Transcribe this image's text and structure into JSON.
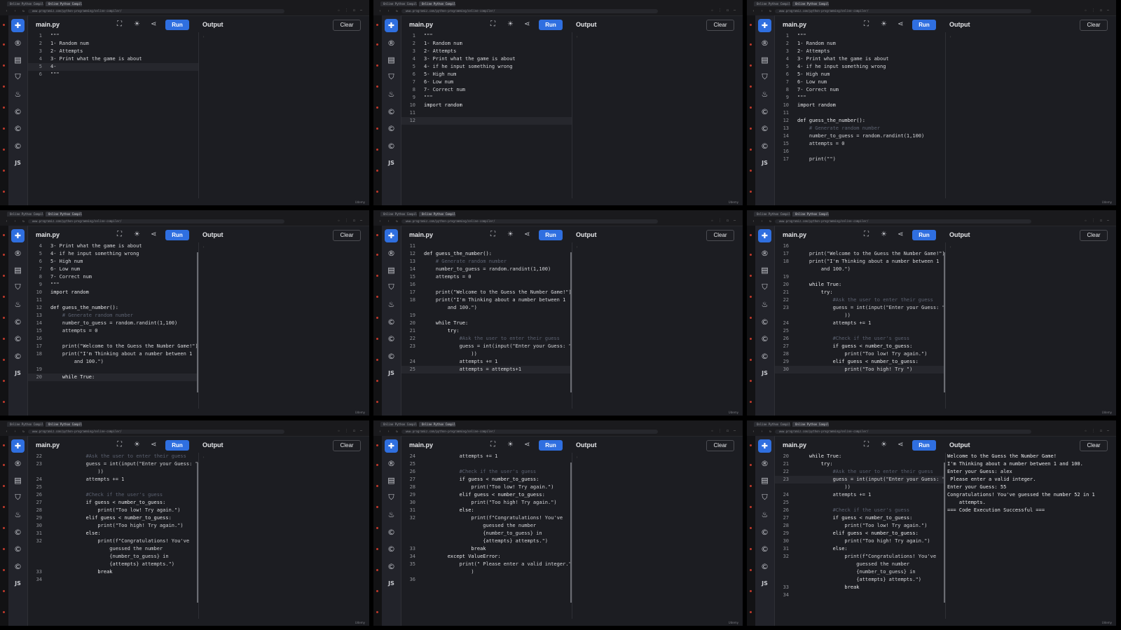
{
  "browser": {
    "tabs": [
      "Online Python Compiler",
      "Online Python Compiler"
    ],
    "url": "www.programiz.com/python-programming/online-compiler/"
  },
  "toolbar": {
    "file_name": "main.py",
    "run_label": "Run",
    "output_label": "Output",
    "clear_label": "Clear"
  },
  "sidebar_icons": [
    "python-icon",
    "r-icon",
    "sql-icon",
    "html-icon",
    "java-icon",
    "c-icon",
    "cpp-icon",
    "csharp-icon",
    "js-icon"
  ],
  "brand": "Udemy",
  "colors": {
    "accent": "#2f6fe0",
    "background": "#1c1d22",
    "sidebar": "#22232a"
  },
  "panels": [
    {
      "lines": [
        {
          "n": "1",
          "t": "\"\"\""
        },
        {
          "n": "2",
          "t": "1- Random num"
        },
        {
          "n": "3",
          "t": "2- Attempts"
        },
        {
          "n": "4",
          "t": "3- Print what the game is about"
        },
        {
          "n": "5",
          "t": "4-",
          "hl": true
        },
        {
          "n": "6",
          "t": "\"\"\""
        }
      ],
      "output": []
    },
    {
      "lines": [
        {
          "n": "1",
          "t": "\"\"\""
        },
        {
          "n": "2",
          "t": "1- Random num"
        },
        {
          "n": "3",
          "t": "2- Attempts"
        },
        {
          "n": "4",
          "t": "3- Print what the game is about"
        },
        {
          "n": "5",
          "t": "4- if he input something wrong"
        },
        {
          "n": "6",
          "t": "5- High num"
        },
        {
          "n": "7",
          "t": "6- Low num"
        },
        {
          "n": "8",
          "t": "7- Correct num"
        },
        {
          "n": "9",
          "t": "\"\"\""
        },
        {
          "n": "10",
          "t": "import random"
        },
        {
          "n": "11",
          "t": ""
        },
        {
          "n": "12",
          "t": "",
          "hl": true
        }
      ],
      "output": []
    },
    {
      "lines": [
        {
          "n": "1",
          "t": "\"\"\""
        },
        {
          "n": "2",
          "t": "1- Random num"
        },
        {
          "n": "3",
          "t": "2- Attempts"
        },
        {
          "n": "4",
          "t": "3- Print what the game is about"
        },
        {
          "n": "5",
          "t": "4- if he input something wrong"
        },
        {
          "n": "6",
          "t": "5- High num"
        },
        {
          "n": "7",
          "t": "6- Low num"
        },
        {
          "n": "8",
          "t": "7- Correct num"
        },
        {
          "n": "9",
          "t": "\"\"\""
        },
        {
          "n": "10",
          "t": "import random"
        },
        {
          "n": "11",
          "t": ""
        },
        {
          "n": "12",
          "t": "def guess_the_number():"
        },
        {
          "n": "13",
          "t": "    # Generate random number"
        },
        {
          "n": "14",
          "t": "    number_to_guess = random.randint(1,100)"
        },
        {
          "n": "15",
          "t": "    attempts = 0"
        },
        {
          "n": "16",
          "t": ""
        },
        {
          "n": "17",
          "t": "    print(\"\")"
        }
      ],
      "output": []
    },
    {
      "lines": [
        {
          "n": "4",
          "t": "3- Print what the game is about"
        },
        {
          "n": "5",
          "t": "4- if he input something wrong"
        },
        {
          "n": "6",
          "t": "5- High num"
        },
        {
          "n": "7",
          "t": "6- Low num"
        },
        {
          "n": "8",
          "t": "7- Correct num"
        },
        {
          "n": "9",
          "t": "\"\"\""
        },
        {
          "n": "10",
          "t": "import random"
        },
        {
          "n": "11",
          "t": ""
        },
        {
          "n": "12",
          "t": "def guess_the_number():"
        },
        {
          "n": "13",
          "t": "    # Generate random number"
        },
        {
          "n": "14",
          "t": "    number_to_guess = random.randint(1,100)"
        },
        {
          "n": "15",
          "t": "    attempts = 0"
        },
        {
          "n": "16",
          "t": ""
        },
        {
          "n": "17",
          "t": "    print(\"Welcome to the Guess the Number Game!\")"
        },
        {
          "n": "18",
          "t": "    print(\"I'm Thinking about a number between 1"
        },
        {
          "n": "",
          "t": "        and 100.\")"
        },
        {
          "n": "19",
          "t": ""
        },
        {
          "n": "20",
          "t": "    while True:",
          "hl": true
        }
      ],
      "output": []
    },
    {
      "lines": [
        {
          "n": "11",
          "t": ""
        },
        {
          "n": "12",
          "t": "def guess_the_number():"
        },
        {
          "n": "13",
          "t": "    # Generate random number"
        },
        {
          "n": "14",
          "t": "    number_to_guess = random.randint(1,100)"
        },
        {
          "n": "15",
          "t": "    attempts = 0"
        },
        {
          "n": "16",
          "t": ""
        },
        {
          "n": "17",
          "t": "    print(\"Welcome to the Guess the Number Game!\")"
        },
        {
          "n": "18",
          "t": "    print(\"I'm Thinking about a number between 1"
        },
        {
          "n": "",
          "t": "        and 100.\")"
        },
        {
          "n": "19",
          "t": ""
        },
        {
          "n": "20",
          "t": "    while True:"
        },
        {
          "n": "21",
          "t": "        try:"
        },
        {
          "n": "22",
          "t": "            #Ask the user to enter their guess"
        },
        {
          "n": "23",
          "t": "            guess = int(input(\"Enter your Guess: \""
        },
        {
          "n": "",
          "t": "                ))"
        },
        {
          "n": "24",
          "t": "            attempts += 1"
        },
        {
          "n": "25",
          "t": "            attempts = attempts+1",
          "hl": true
        }
      ],
      "output": []
    },
    {
      "lines": [
        {
          "n": "16",
          "t": ""
        },
        {
          "n": "17",
          "t": "    print(\"Welcome to the Guess the Number Game!\")"
        },
        {
          "n": "18",
          "t": "    print(\"I'm Thinking about a number between 1"
        },
        {
          "n": "",
          "t": "        and 100.\")"
        },
        {
          "n": "19",
          "t": ""
        },
        {
          "n": "20",
          "t": "    while True:"
        },
        {
          "n": "21",
          "t": "        try:"
        },
        {
          "n": "22",
          "t": "            #Ask the user to enter their guess"
        },
        {
          "n": "23",
          "t": "            guess = int(input(\"Enter your Guess: \""
        },
        {
          "n": "",
          "t": "                ))"
        },
        {
          "n": "24",
          "t": "            attempts += 1"
        },
        {
          "n": "25",
          "t": ""
        },
        {
          "n": "26",
          "t": "            #Check if the user's guess"
        },
        {
          "n": "27",
          "t": "            if guess < number_to_guess:"
        },
        {
          "n": "28",
          "t": "                print(\"Too low! Try again.\")"
        },
        {
          "n": "29",
          "t": "            elif guess < number_to_guess:"
        },
        {
          "n": "30",
          "t": "                print(\"Too high! Try \")",
          "hl": true
        }
      ],
      "output": []
    },
    {
      "lines": [
        {
          "n": "22",
          "t": "            #Ask the user to enter their guess"
        },
        {
          "n": "23",
          "t": "            guess = int(input(\"Enter your Guess: \""
        },
        {
          "n": "",
          "t": "                ))"
        },
        {
          "n": "24",
          "t": "            attempts += 1"
        },
        {
          "n": "25",
          "t": ""
        },
        {
          "n": "26",
          "t": "            #Check if the user's guess"
        },
        {
          "n": "27",
          "t": "            if guess < number_to_guess:"
        },
        {
          "n": "28",
          "t": "                print(\"Too low! Try again.\")"
        },
        {
          "n": "29",
          "t": "            elif guess < number_to_guess:"
        },
        {
          "n": "30",
          "t": "                print(\"Too high! Try again.\")"
        },
        {
          "n": "31",
          "t": "            else:"
        },
        {
          "n": "32",
          "t": "                print(f\"Congratulations! You've"
        },
        {
          "n": "",
          "t": "                    guessed the number"
        },
        {
          "n": "",
          "t": "                    {number_to_guess} in"
        },
        {
          "n": "",
          "t": "                    {attempts} attempts.\")"
        },
        {
          "n": "33",
          "t": "                break"
        },
        {
          "n": "34",
          "t": ""
        }
      ],
      "output": []
    },
    {
      "lines": [
        {
          "n": "24",
          "t": "            attempts += 1"
        },
        {
          "n": "25",
          "t": ""
        },
        {
          "n": "26",
          "t": "            #Check if the user's guess"
        },
        {
          "n": "27",
          "t": "            if guess < number_to_guess:"
        },
        {
          "n": "28",
          "t": "                print(\"Too low! Try again.\")"
        },
        {
          "n": "29",
          "t": "            elif guess < number_to_guess:"
        },
        {
          "n": "30",
          "t": "                print(\"Too high! Try again.\")"
        },
        {
          "n": "31",
          "t": "            else:"
        },
        {
          "n": "32",
          "t": "                print(f\"Congratulations! You've"
        },
        {
          "n": "",
          "t": "                    guessed the number"
        },
        {
          "n": "",
          "t": "                    {number_to_guess} in"
        },
        {
          "n": "",
          "t": "                    {attempts} attempts.\")"
        },
        {
          "n": "33",
          "t": "                break"
        },
        {
          "n": "34",
          "t": "        except ValueError:"
        },
        {
          "n": "35",
          "t": "            print(\" Please enter a valid integer.\""
        },
        {
          "n": "",
          "t": "                )"
        },
        {
          "n": "36",
          "t": ""
        }
      ],
      "output": []
    },
    {
      "lines": [
        {
          "n": "20",
          "t": "    while True:"
        },
        {
          "n": "21",
          "t": "        try:"
        },
        {
          "n": "22",
          "t": "            #Ask the user to enter their guess"
        },
        {
          "n": "23",
          "t": "            guess = int(input(\"Enter your Guess: \"",
          "hl": true
        },
        {
          "n": "",
          "t": "                ))"
        },
        {
          "n": "24",
          "t": "            attempts += 1"
        },
        {
          "n": "25",
          "t": ""
        },
        {
          "n": "26",
          "t": "            #Check if the user's guess"
        },
        {
          "n": "27",
          "t": "            if guess < number_to_guess:"
        },
        {
          "n": "28",
          "t": "                print(\"Too low! Try again.\")"
        },
        {
          "n": "29",
          "t": "            elif guess < number_to_guess:"
        },
        {
          "n": "30",
          "t": "                print(\"Too high! Try again.\")"
        },
        {
          "n": "31",
          "t": "            else:"
        },
        {
          "n": "32",
          "t": "                print(f\"Congratulations! You've"
        },
        {
          "n": "",
          "t": "                    guessed the number"
        },
        {
          "n": "",
          "t": "                    {number_to_guess} in"
        },
        {
          "n": "",
          "t": "                    {attempts} attempts.\")"
        },
        {
          "n": "33",
          "t": "                break"
        },
        {
          "n": "34",
          "t": ""
        }
      ],
      "output": [
        "Welcome to the Guess the Number Game!",
        "I'm Thinking about a number between 1 and 100.",
        "Enter your Guess: alex",
        " Please enter a valid integer.",
        "Enter your Guess: 55",
        "Congratulations! You've guessed the number 52 in 1",
        "    attempts.",
        "",
        "=== Code Execution Successful ==="
      ]
    }
  ]
}
